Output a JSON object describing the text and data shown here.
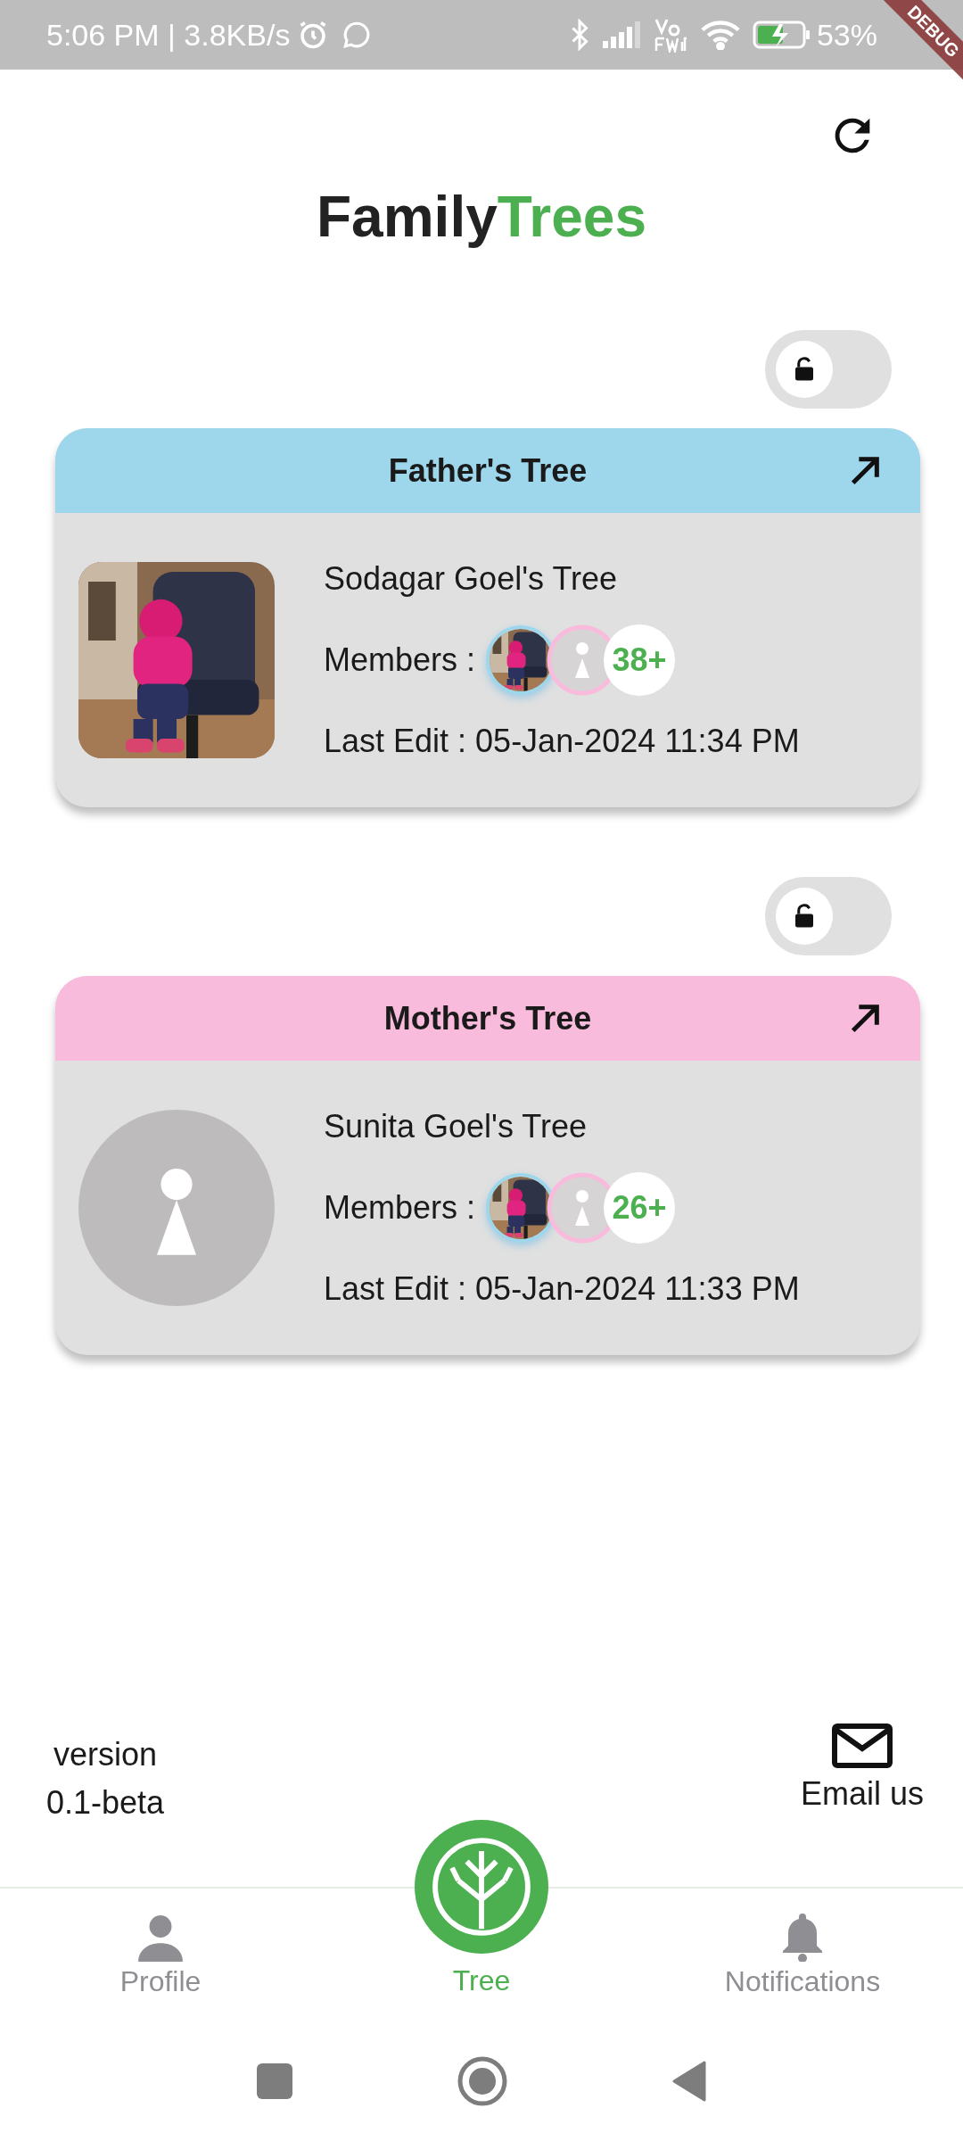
{
  "status_bar": {
    "time": "5:06 PM | 3.8KB/s",
    "battery": "53%",
    "banner": "DEBUG"
  },
  "app_title": {
    "first": "Family",
    "second": "Trees"
  },
  "trees": [
    {
      "header": "Father's Tree",
      "color": "#9ed6ec",
      "locked": false,
      "name": "Sodagar Goel's Tree",
      "members_label": "Members :",
      "member_count": "38+",
      "last_edit": "Last Edit : 05-Jan-2024 11:34 PM"
    },
    {
      "header": "Mother's Tree",
      "color": "#f9bbdc",
      "locked": false,
      "kind": "placeholder",
      "name": "Sunita Goel's Tree",
      "members_label": "Members :",
      "member_count": "26+",
      "last_edit": "Last Edit : 05-Jan-2024 11:33 PM"
    }
  ],
  "footer": {
    "version_label": "version",
    "version": "0.1-beta",
    "email": "Email us"
  },
  "nav": [
    {
      "label": "Profile",
      "kind": "person",
      "selected": false
    },
    {
      "label": "Tree",
      "kind": "tree",
      "selected": true
    },
    {
      "label": "Notifications",
      "kind": "bell",
      "selected": false
    }
  ]
}
